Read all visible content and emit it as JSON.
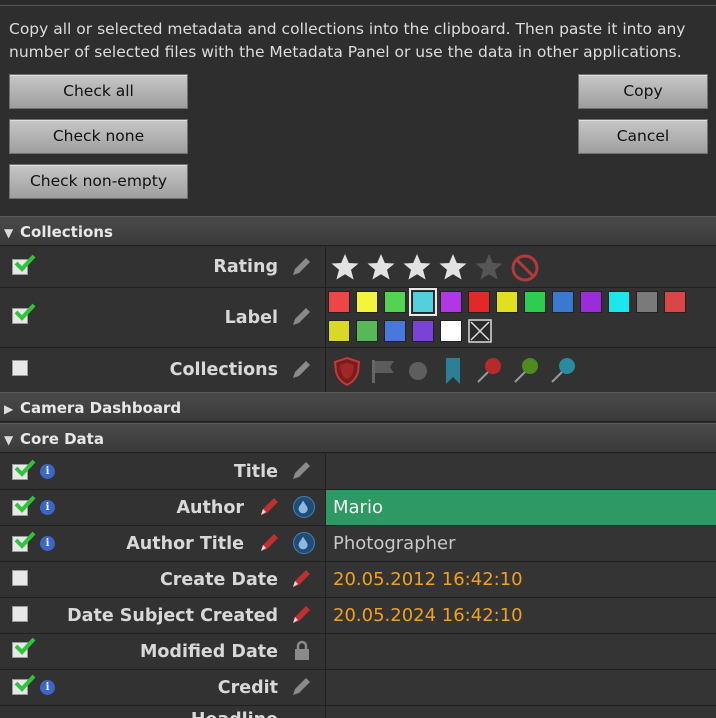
{
  "description": "Copy all or selected metadata and collections into the clipboard. Then paste it into any number of selected files with the Metadata Panel or use the data in other applications.",
  "buttons": {
    "check_all": "Check all",
    "check_none": "Check none",
    "check_non_empty": "Check non-empty",
    "copy": "Copy",
    "cancel": "Cancel"
  },
  "sections": {
    "collections": "Collections",
    "camera_dashboard": "Camera Dashboard",
    "core_data": "Core Data"
  },
  "collections_rows": {
    "rating": "Rating",
    "label": "Label",
    "collections": "Collections"
  },
  "rating": {
    "value": 4,
    "max": 5
  },
  "label_colors": [
    "#ee4646",
    "#f4f43a",
    "#52d452",
    "#52d0dc",
    "#b236e6",
    "#e42828",
    "#e0e020",
    "#2ecc50",
    "#3a78d2",
    "#9a2cdc",
    "#1ae8ec",
    "#7a7a7a",
    "#d84646",
    "#d8d828",
    "#56b856",
    "#4878dc",
    "#7a42d6",
    "#ffffff"
  ],
  "collection_icons": [
    "shield-icon",
    "flag-icon",
    "circle-icon",
    "bookmark-icon",
    "pin-red-icon",
    "pin-green-icon",
    "pin-blue-icon"
  ],
  "core_rows": {
    "title": {
      "label": "Title",
      "value": ""
    },
    "author": {
      "label": "Author",
      "value": "Mario"
    },
    "author_title": {
      "label": "Author Title",
      "value": "Photographer"
    },
    "create_date": {
      "label": "Create Date",
      "value": "20.05.2012 16:42:10"
    },
    "date_subject_created": {
      "label": "Date Subject Created",
      "value": "20.05.2024 16:42:10"
    },
    "modified_date": {
      "label": "Modified Date",
      "value": ""
    },
    "credit": {
      "label": "Credit",
      "value": ""
    },
    "headline": {
      "label": "Headline",
      "value": ""
    }
  },
  "colors": {
    "accent_green": "#2f9966",
    "date_orange": "#f0a020",
    "info_blue": "#3b66c4"
  }
}
